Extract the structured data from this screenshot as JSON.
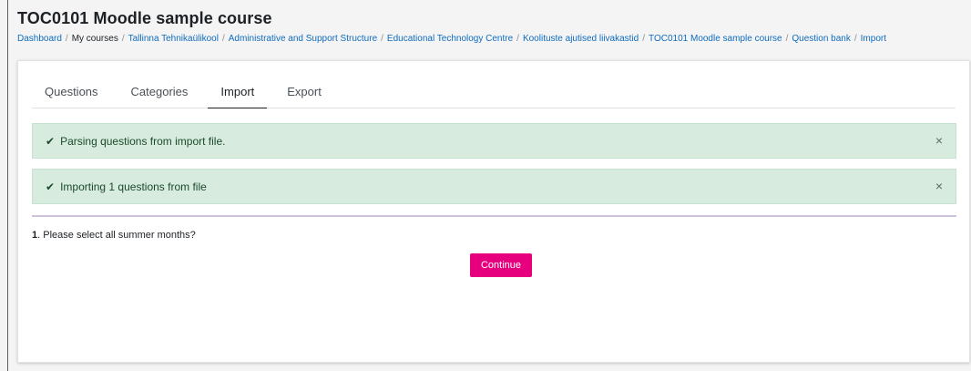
{
  "page": {
    "course_title": "TOC0101 Moodle sample course"
  },
  "breadcrumb": [
    {
      "label": "Dashboard",
      "link": true
    },
    {
      "label": "My courses",
      "link": false
    },
    {
      "label": "Tallinna Tehnikaülikool",
      "link": true
    },
    {
      "label": "Administrative and Support Structure",
      "link": true
    },
    {
      "label": "Educational Technology Centre",
      "link": true
    },
    {
      "label": "Koolituste ajutised liivakastid",
      "link": true
    },
    {
      "label": "TOC0101 Moodle sample course",
      "link": true
    },
    {
      "label": "Question bank",
      "link": true
    },
    {
      "label": "Import",
      "link": true
    }
  ],
  "breadcrumb_separator": "/",
  "tabs": [
    {
      "label": "Questions",
      "active": false
    },
    {
      "label": "Categories",
      "active": false
    },
    {
      "label": "Import",
      "active": true
    },
    {
      "label": "Export",
      "active": false
    }
  ],
  "alerts": [
    {
      "icon": "check-icon",
      "text": "Parsing questions from import file.",
      "close": "×"
    },
    {
      "icon": "check-icon",
      "text": "Importing 1 questions from file",
      "close": "×"
    }
  ],
  "question": {
    "number": "1",
    "text": "Please select all summer months?"
  },
  "continue_button": "Continue",
  "colors": {
    "accent": "#e6007e",
    "link": "#0f6cbf",
    "alert_bg": "#d7ecde",
    "alert_text": "#1c4a2b"
  }
}
